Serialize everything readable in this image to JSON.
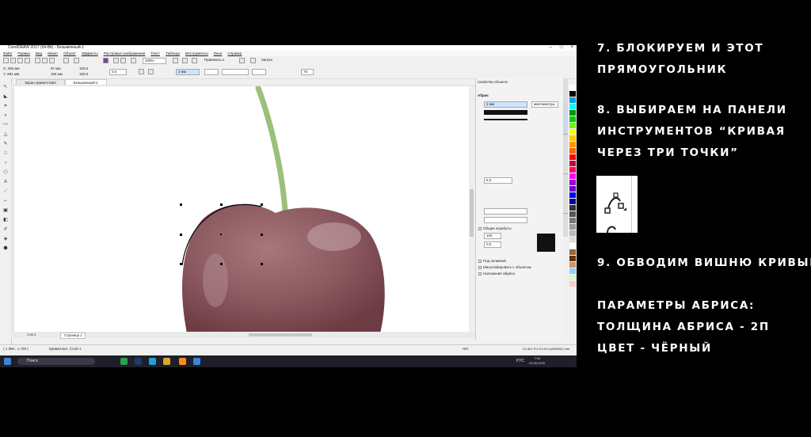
{
  "app": {
    "title": "CorelDRAW 2017 (64-Bit) - Безымянный-1",
    "window_controls": [
      "–",
      "□",
      "×"
    ],
    "menu": [
      "Файл",
      "Правка",
      "Вид",
      "Макет",
      "Объект",
      "Эффекты",
      "Растровые изображения",
      "Текст",
      "Таблица",
      "Инструменты",
      "Окно",
      "Справка"
    ]
  },
  "toolbar": {
    "zoom": "100%",
    "snap_label": "Привязать к",
    "launch_label": "Запуск"
  },
  "property_bar": {
    "x": "X: 306 мм",
    "y": "Y: 891 мм",
    "w": "97 мм",
    "h": "184 мм",
    "sx": "100,0",
    "sy": "100,0",
    "angle": "0,0",
    "outline_width": "2 мм",
    "smooth": "78"
  },
  "tabs": [
    "Экран приветствия",
    "Безымянный-1"
  ],
  "page_nav": {
    "position": "1 из 1",
    "page_tab": "Страница 1"
  },
  "panel": {
    "title": "Свойства объекта",
    "section": "Абрис",
    "width": "2 мм",
    "units": "миллиметры",
    "miter": "5,0",
    "common_attrs": "Общие атрибуты",
    "pct_a": "100",
    "pct_b": "0,0",
    "opt1": "Под заливкой",
    "opt2": "Масштабировать с объектом",
    "opt3": "Наложение абриса",
    "dock_tabs": [
      "Свойства объекта",
      "Диспетчер объектов",
      "Снимок экрана"
    ]
  },
  "status": {
    "coords": "( 1 356 ; 1 728 )",
    "hint": "Кривая вкл. Слой 1",
    "fill": "Нет",
    "outline": "5,0 Ш/С R:0 G:0 B:0 (#000000)  2 мм"
  },
  "taskbar": {
    "search": "Поиск",
    "lang": "РУС",
    "time": "7:08",
    "date": "22.06.2025"
  },
  "palette_colors": [
    "#ffffff",
    "#000000",
    "#00a0e0",
    "#00ffff",
    "#009900",
    "#00cc00",
    "#66ff00",
    "#ffff00",
    "#ffcc00",
    "#ff9900",
    "#ff6600",
    "#ff0000",
    "#cc0033",
    "#ff0066",
    "#ff00ff",
    "#9900cc",
    "#6600cc",
    "#0000ff",
    "#000099",
    "#333333",
    "#555555",
    "#777777",
    "#999999",
    "#bbbbbb",
    "#dddddd",
    "#ffffff",
    "#996633",
    "#663300",
    "#cc9966",
    "#99ccff",
    "#ccffcc",
    "#ffcccc"
  ],
  "captions": {
    "c1": "7. БЛОКИРУЕМ И ЭТОТ",
    "c2": "ПРЯМОУГОЛЬНИК",
    "c3": "8. ВЫБИРАЕМ НА ПАНЕЛИ",
    "c4": "ИНСТРУМЕНТОВ “КРИВАЯ",
    "c5": "ЧЕРЕЗ ТРИ ТОЧКИ”",
    "c6": "9. ОБВОДИМ ВИШНЮ КРИВЫМИ",
    "c7": "ПАРАМЕТРЫ АБРИСА:",
    "c8": "ТОЛЩИНА АБРИСА - 2П",
    "c9": "ЦВЕТ - ЧЁРНЫЙ"
  },
  "icons": {
    "three_point_curve": "three-point-curve-icon"
  }
}
